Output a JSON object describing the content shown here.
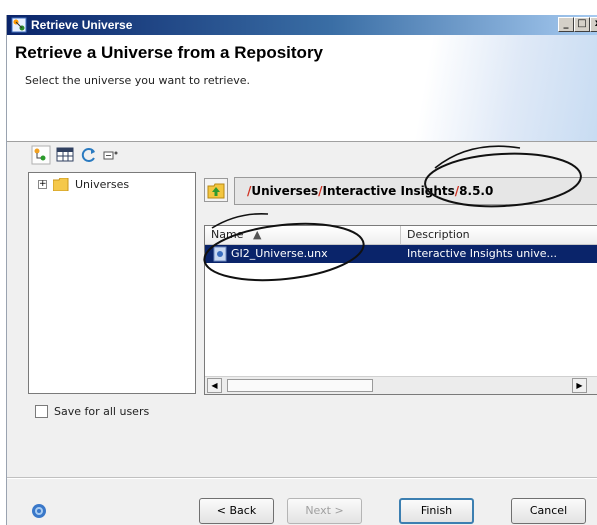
{
  "window": {
    "title": "Retrieve Universe"
  },
  "header": {
    "title": "Retrieve a Universe from a Repository",
    "subtitle": "Select the universe you want to retrieve."
  },
  "toolbar": {
    "icons": [
      "connection-icon",
      "table-icon",
      "refresh-icon",
      "options-icon"
    ]
  },
  "tree": {
    "items": [
      {
        "label": "Universes",
        "expander": "+",
        "icon": "folder-icon"
      }
    ]
  },
  "path": {
    "sep": "/",
    "segments": [
      "Universes",
      "Interactive Insights",
      "8.5.0"
    ]
  },
  "list": {
    "columns": [
      "Name",
      "Description"
    ],
    "rows": [
      {
        "name": "GI2_Universe.unx",
        "description": "Interactive Insights unive..."
      }
    ]
  },
  "options": {
    "save_all_users_label": "Save for all users",
    "save_all_users_checked": false
  },
  "buttons": {
    "back": "< Back",
    "next": "Next >",
    "finish": "Finish",
    "cancel": "Cancel"
  },
  "colors": {
    "selection": "#0a246a",
    "path_separator": "#d03020",
    "title_bar": "#0a246a"
  }
}
